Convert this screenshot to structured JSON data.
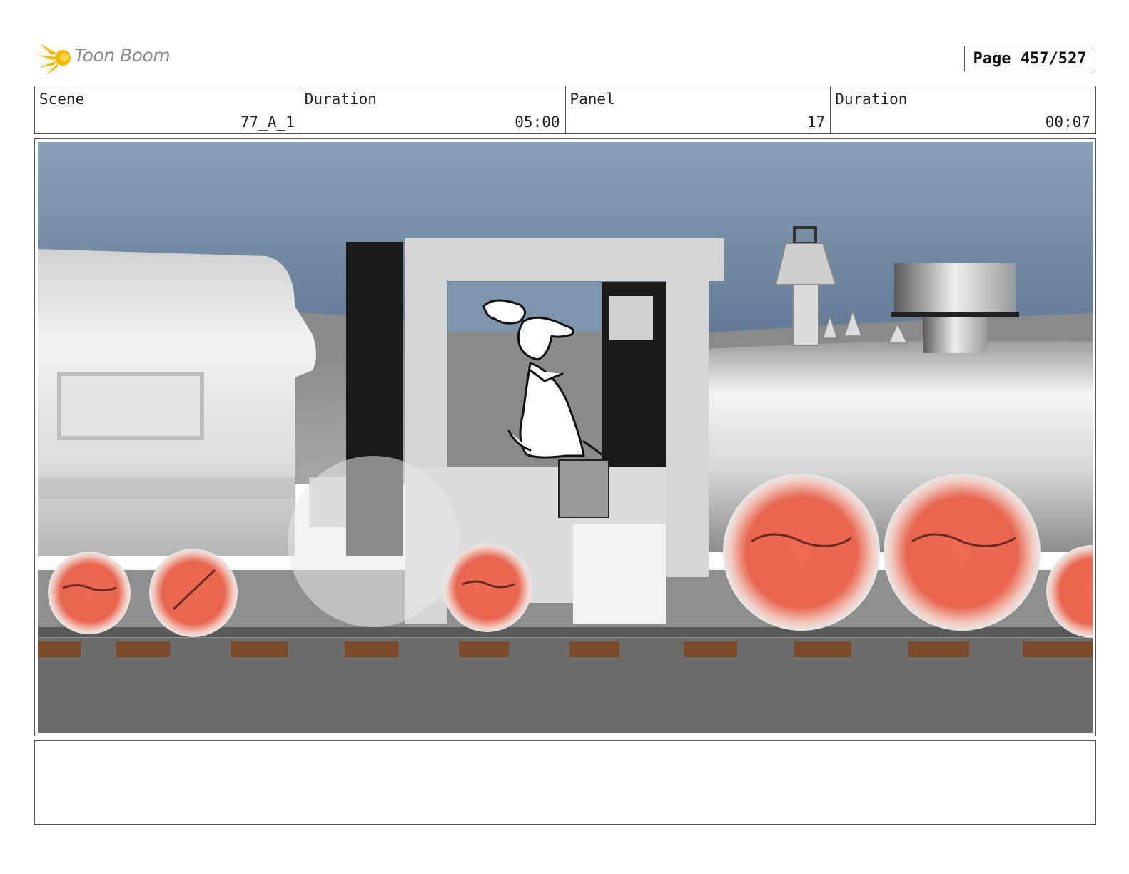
{
  "header": {
    "logo_text": "Toon Boom",
    "page_label": "Page 457/527"
  },
  "info": {
    "scene_label": "Scene",
    "scene_value": "77_A_1",
    "duration_label": "Duration",
    "duration_value": "05:00",
    "panel_label": "Panel",
    "panel_value": "17",
    "panel_duration_label": "Duration",
    "panel_duration_value": "00:07"
  },
  "colors": {
    "logo_yellow": "#f5b800",
    "wheel_red": "#e8654f",
    "sky_top": "#8aa0b8",
    "sky_bottom": "#5e7690",
    "ground": "#6b6b6b",
    "tie_brown": "#7a4a2a"
  },
  "notes": {
    "text": ""
  }
}
